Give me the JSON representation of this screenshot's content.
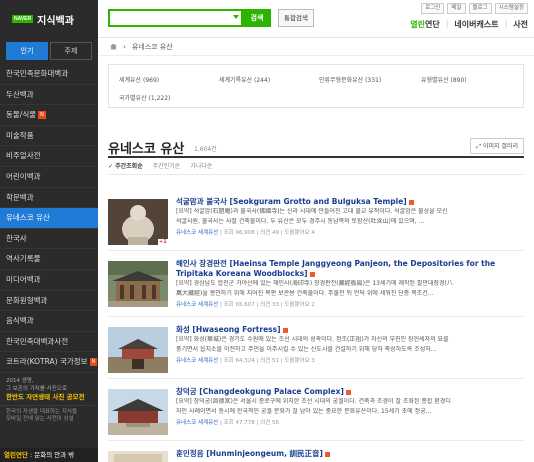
{
  "sidebar": {
    "logo": "NAVER",
    "brand_title": "지식백과",
    "tabs": [
      "인기",
      "주제"
    ],
    "items": [
      {
        "label": "한국민족문화대백과",
        "active": false,
        "new": false
      },
      {
        "label": "두산백과",
        "active": false,
        "new": false
      },
      {
        "label": "동물/식물",
        "active": false,
        "new": true
      },
      {
        "label": "미술작품",
        "active": false,
        "new": false
      },
      {
        "label": "비주얼사전",
        "active": false,
        "new": false
      },
      {
        "label": "어린이백과",
        "active": false,
        "new": false
      },
      {
        "label": "학문백과",
        "active": false,
        "new": false
      },
      {
        "label": "유네스코 유산",
        "active": true,
        "new": false
      },
      {
        "label": "한국사",
        "active": false,
        "new": false
      },
      {
        "label": "역사기록물",
        "active": false,
        "new": false
      },
      {
        "label": "미디어백과",
        "active": false,
        "new": false
      },
      {
        "label": "문화원형백과",
        "active": false,
        "new": false
      },
      {
        "label": "음식백과",
        "active": false,
        "new": false
      },
      {
        "label": "한국민족대백과사전",
        "active": false,
        "new": false
      },
      {
        "label": "코트라(KOTRA) 국가정보",
        "active": false,
        "new": true
      }
    ],
    "promo_line1": "2014 생명,",
    "promo_line2": "그 보존의 가치를 사진으로",
    "promo_highlight": "한반도 자연생태 사진 공모전",
    "promo_small1": "한국의 자생을 대표하는 지식을",
    "promo_small2": "모바일 전에 읽는 사전이 상설",
    "footer_highlight": "열린연단",
    "footer_text": " : 문화의 안과 밖"
  },
  "topbar": {
    "search_placeholder": "",
    "search_label": "검색",
    "combined_label": "통합검색",
    "util_links": [
      "로그인",
      "메일",
      "블로그",
      "시스템설정"
    ],
    "nav_open_a": "열린",
    "nav_open_b": "연단",
    "nav_cast": "네이버캐스트",
    "nav_dict": "사전",
    "nav_sep": "|"
  },
  "breadcrumb": {
    "sep": "›",
    "current": "유네스코 유산"
  },
  "categories": [
    {
      "label": "세계유산 (969)"
    },
    {
      "label": "세계기록유산 (244)"
    },
    {
      "label": "인류무형문화유산 (331)"
    },
    {
      "label": "유형별유산 (890)"
    },
    {
      "label": "국가별유산 (1,222)"
    }
  ],
  "section": {
    "title": "유네스코 유산",
    "count": "1,604건",
    "gallery_label": "이미지 갤러리"
  },
  "sort_tabs": [
    "✓ 주간조회순",
    "주간인기순",
    "가나다순"
  ],
  "entries": [
    {
      "title": "석굴암과 불국사 [Seokguram Grotto and Bulguksa Temple]",
      "desc1": "[요약] 석굴암(石窟庵)과 불국사(佛國寺)는 신라 시대에 만들어진 고대 불교 유적이다. 석굴암은 불상을 모신",
      "desc2": "석굴사원, 불국사는 사찰 건축물이다. 두 유산은 모두 경주시 동남쪽의 토함산(吐含山)에 있으며, ...",
      "source": "유네스코 세계유산",
      "views": "조회 96,908",
      "comments": "의견 49",
      "shares": "도움됐어요 4",
      "badge": "+1"
    },
    {
      "title": "해인사 장경판전 [Haeinsa Temple Janggyeong Panjeon, the Depositories for the Tripitaka Koreana Woodblocks]",
      "desc1": "[요약] 경상남도 합천군 가야산에 있는 해인사(海印寺) 장경판전(藏經板殿)은 13세기에 제작된 팔만대장경(八",
      "desc2": "萬大藏經)을 봉안하기 위해 지어진 목판 보관용 건축물이다. 주불전 뒤 언덕 위에 세워진 단층 목조건...",
      "source": "유네스코 세계유산",
      "views": "조회 65,607",
      "comments": "의견 33",
      "shares": "도움됐어요 2",
      "badge": ""
    },
    {
      "title": "화성 [Hwaseong Fortress]",
      "desc1": "[요약] 화성(華城)은 경기도 수원에 있는 조선 시대의 성곽이다. 정조(正祖)가 자신의 부친인 장헌세자의 묘를",
      "desc2": "풍기면서 읍치소를 이전하고 주민을 이주시킬 수 있는 신도시를 건설하기 위해 당하 축성하도록 조성하...",
      "source": "유네스코 세계유산",
      "views": "조회 64,324",
      "comments": "의견 51",
      "shares": "도움됐어요 3",
      "badge": ""
    },
    {
      "title": "창덕궁 [Changdeokgung Palace Complex]",
      "desc1": "[요약] 창덕궁(昌德宮)은 서울시 종로구에 위치한 조선 시대의 궁궐이다. 건축과 조경이 잘 조화된 종합 환경디",
      "desc2": "자인 사례이면서 동시에 한국적인 궁궐 문화가 잘 남아 있는 중요한 문화유산이다. 15세기 초에 정궁...",
      "source": "유네스코 세계유산",
      "views": "조회 47,778",
      "comments": "의견 56",
      "shares": "",
      "badge": ""
    },
    {
      "title": "훈민정음 [Hunminjeongeum, 訓民正音]",
      "desc1": "",
      "desc2": "",
      "source": "",
      "views": "",
      "comments": "",
      "shares": "",
      "badge": ""
    }
  ],
  "colors": {
    "accent": "#2db400",
    "sidebar_bg": "#2b2b2b",
    "active": "#1f7bd6",
    "link": "#1a3d8f"
  }
}
